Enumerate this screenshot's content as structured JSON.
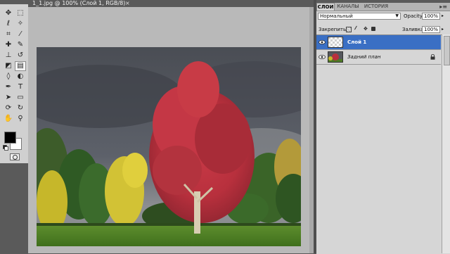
{
  "document": {
    "title": "1_1.jpg @ 100% (Слой 1, RGB/8)",
    "close_glyph": "×",
    "close_icon": "close-icon"
  },
  "tools": {
    "items": [
      {
        "icon": "move-icon",
        "glyph": "✥"
      },
      {
        "icon": "rect-marquee-icon",
        "glyph": "⬚"
      },
      {
        "icon": "lasso-icon",
        "glyph": "ℓ"
      },
      {
        "icon": "magic-wand-icon",
        "glyph": "✧"
      },
      {
        "icon": "crop-icon",
        "glyph": "⌗"
      },
      {
        "icon": "eyedropper-icon",
        "glyph": "⁄"
      },
      {
        "icon": "healing-brush-icon",
        "glyph": "✚"
      },
      {
        "icon": "brush-icon",
        "glyph": "✎"
      },
      {
        "icon": "clone-stamp-icon",
        "glyph": "⊥"
      },
      {
        "icon": "history-brush-icon",
        "glyph": "↺"
      },
      {
        "icon": "eraser-icon",
        "glyph": "◩"
      },
      {
        "icon": "gradient-icon",
        "glyph": "▤"
      },
      {
        "icon": "blur-icon",
        "glyph": "◊"
      },
      {
        "icon": "dodge-icon",
        "glyph": "◐"
      },
      {
        "icon": "pen-icon",
        "glyph": "✒"
      },
      {
        "icon": "type-icon",
        "glyph": "T"
      },
      {
        "icon": "path-selection-icon",
        "glyph": "➤"
      },
      {
        "icon": "shape-icon",
        "glyph": "▭"
      },
      {
        "icon": "3d-rotate-icon",
        "glyph": "⟳"
      },
      {
        "icon": "3d-orbit-icon",
        "glyph": "↻"
      },
      {
        "icon": "hand-icon",
        "glyph": "✋"
      },
      {
        "icon": "zoom-icon",
        "glyph": "⚲"
      }
    ],
    "selected_icon": "gradient-icon",
    "foreground_color": "#000000",
    "background_color": "#ffffff"
  },
  "panel": {
    "tabs": [
      {
        "label": "СЛОИ",
        "active": true
      },
      {
        "label": "КАНАЛЫ",
        "active": false
      },
      {
        "label": "ИСТОРИЯ",
        "active": false
      }
    ],
    "menu_glyph": "▸≡",
    "blend_mode": "Нормальный",
    "opacity_label": "Opacity:",
    "opacity_value": "100%",
    "lock_label": "Закрепить:",
    "fill_label": "Заливка:",
    "fill_value": "100%",
    "layers": [
      {
        "name": "Слой 1",
        "selected": true,
        "locked": false,
        "thumb": "transparent"
      },
      {
        "name": "Задний план",
        "selected": false,
        "locked": true,
        "thumb": "photo"
      }
    ]
  },
  "colors": {
    "accent_selected_layer": "#3a6fc4",
    "workspace_gray": "#b9b9b9",
    "panel_gray": "#d6d6d6",
    "app_dark": "#5a5a5a"
  }
}
